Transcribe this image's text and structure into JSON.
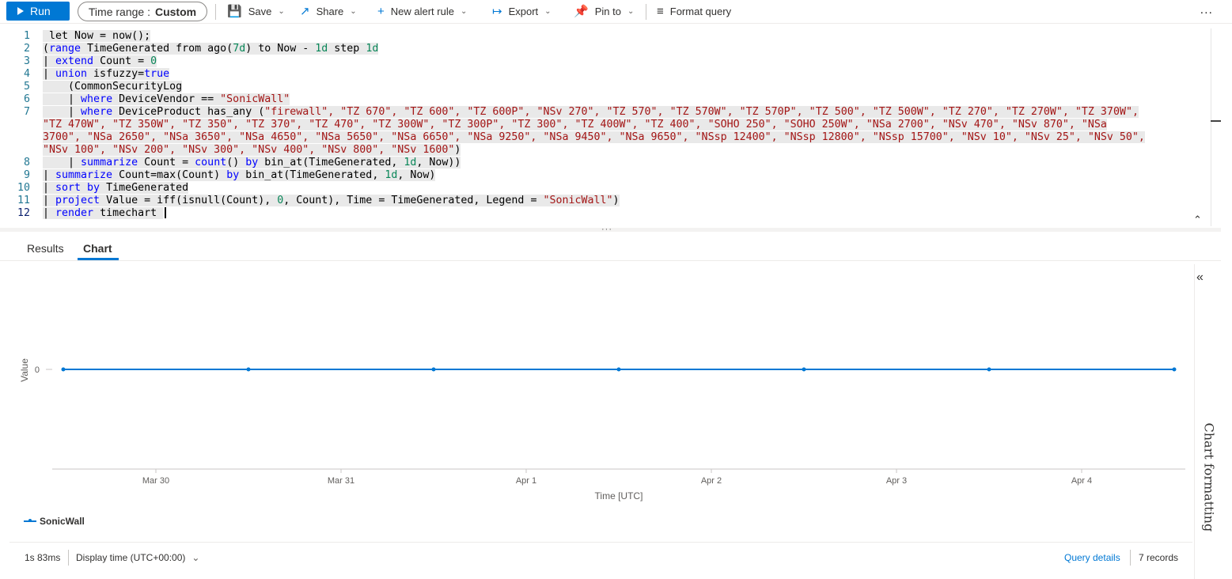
{
  "toolbar": {
    "run_label": "Run",
    "time_range_label": "Time range :",
    "time_range_value": "Custom",
    "save_label": "Save",
    "share_label": "Share",
    "new_alert_label": "New alert rule",
    "export_label": "Export",
    "pin_label": "Pin to",
    "format_label": "Format query",
    "more_label": "..."
  },
  "editor": {
    "line_numbers": [
      "1",
      "2",
      "3",
      "4",
      "5",
      "6",
      "7",
      "8",
      "9",
      "10",
      "11",
      "12"
    ]
  },
  "tabs": {
    "results": "Results",
    "chart": "Chart"
  },
  "chart_data": {
    "type": "line",
    "x": [
      "2025-03-29",
      "2025-03-30",
      "2025-03-31",
      "2025-04-01",
      "2025-04-02",
      "2025-04-03",
      "2025-04-04"
    ],
    "tick_labels": [
      "Mar 30",
      "Mar 31",
      "Apr 1",
      "Apr 2",
      "Apr 3",
      "Apr 4"
    ],
    "y_ticks": [
      "0"
    ],
    "series": [
      {
        "name": "SonicWall",
        "values": [
          0,
          0,
          0,
          0,
          0,
          0,
          0
        ]
      }
    ],
    "xlabel": "Time [UTC]",
    "ylabel": "Value",
    "legend_position": "bottom-left",
    "line_color": "#0078d4"
  },
  "side_panel": {
    "label": "Chart formatting"
  },
  "footer": {
    "duration": "1s 83ms",
    "display_time": "Display time (UTC+00:00)",
    "query_details": "Query details",
    "records": "7 records"
  }
}
